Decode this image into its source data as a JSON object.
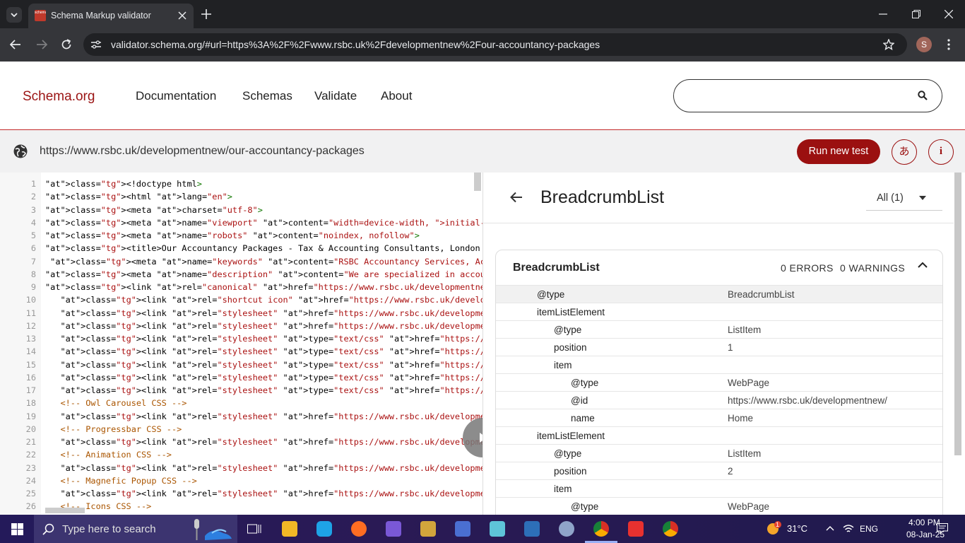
{
  "browser": {
    "tab_title": "Schema Markup validator",
    "tab_favicon_text": "schema.org",
    "url": "validator.schema.org/#url=https%3A%2F%2Fwww.rsbc.uk%2Fdevelopmentnew%2Four-accountancy-packages",
    "profile_initial": "S"
  },
  "site": {
    "logo": "Schema.org",
    "nav": [
      "Documentation",
      "Schemas",
      "Validate",
      "About"
    ],
    "search_placeholder": ""
  },
  "test": {
    "url": "https://www.rsbc.uk/developmentnew/our-accountancy-packages",
    "run_label": "Run new test",
    "lang_label": "あ",
    "info_label": "i"
  },
  "code": {
    "line_numbers": [
      "1",
      "2",
      "3",
      "4",
      "5",
      "6",
      "7",
      "8",
      "9",
      "10",
      "11",
      "12",
      "13",
      "14",
      "15",
      "16",
      "17",
      "18",
      "19",
      "20",
      "21",
      "22",
      "23",
      "24",
      "25",
      "26"
    ],
    "lines": [
      "<!doctype html>",
      "<html lang=\"en\">",
      "<meta charset=\"utf-8\">",
      "<meta name=\"viewport\" content=\"width=device-width, initial-scale=1\">",
      "<meta name=\"robots\" content=\"noindex, nofollow\">",
      "<title>Our Accountancy Packages - Tax & Accounting Consultants, London | Management Acc",
      " <meta name=\"keywords\" content=\"RSBC Accountancy Services, Accounts, Tax, Payroll, Mana",
      "<meta name=\"description\" content=\"We are specialized in accountancy and tax advice prov",
      "<link rel=\"canonical\" href=\"https://www.rsbc.uk/developmentnew/our-accountancy-packages",
      "   <link rel=\"shortcut icon\" href=\"https://www.rsbc.uk/developmentnew/images/favicon.ic",
      "   <link rel=\"stylesheet\" href=\"https://www.rsbc.uk/developmentnew/css/bootstrap.min.cs",
      "   <link rel=\"stylesheet\" href=\"https://www.rsbc.uk/developmentnew/css/jquery.mCustomSc",
      "   <link rel=\"stylesheet\" type=\"text/css\" href=\"https://www.rsbc.uk/developmentnew/css/",
      "   <link rel=\"stylesheet\" type=\"text/css\" href=\"https://www.rsbc.uk/developmentnew/css/",
      "   <link rel=\"stylesheet\" type=\"text/css\" href=\"https://www.rsbc.uk/developmentnew/css/",
      "   <link rel=\"stylesheet\" type=\"text/css\" href=\"https://www.rsbc.uk/developmentnew/css/",
      "   <link rel=\"stylesheet\" type=\"text/css\" href=\"https://www.rsbc.uk/developmentnew/css/",
      "   <!-- Owl Carousel CSS -->",
      "   <link rel=\"stylesheet\" href=\"https://www.rsbc.uk/developmentnew/css/owl.carousel.min",
      "   <!-- Progressbar CSS -->",
      "   <link rel=\"stylesheet\" href=\"https://www.rsbc.uk/developmentnew/css/progressbar.",
      "   <!-- Animation CSS -->",
      "   <link rel=\"stylesheet\" href=\"https://www.rsbc.uk/developmentnew/css/animations.min.c",
      "   <!-- Magnefic Popup CSS -->",
      "   <link rel=\"stylesheet\" href=\"https://www.rsbc.uk/developmentnew/css/magnific-popup.m",
      "   <!-- Icons CSS -->"
    ]
  },
  "results": {
    "title": "BreadcrumbList",
    "filter": "All (1)",
    "card": {
      "heading": "BreadcrumbList",
      "errors": "0 ERRORS",
      "warnings": "0 WARNINGS",
      "rows": [
        {
          "key": "@type",
          "value": "BreadcrumbList",
          "level": 0
        },
        {
          "key": "itemListElement",
          "value": "",
          "level": 0
        },
        {
          "key": "@type",
          "value": "ListItem",
          "level": 1
        },
        {
          "key": "position",
          "value": "1",
          "level": 1
        },
        {
          "key": "item",
          "value": "",
          "level": 1
        },
        {
          "key": "@type",
          "value": "WebPage",
          "level": 2
        },
        {
          "key": "@id",
          "value": "https://www.rsbc.uk/developmentnew/",
          "level": 2
        },
        {
          "key": "name",
          "value": "Home",
          "level": 2
        },
        {
          "key": "itemListElement",
          "value": "",
          "level": 0
        },
        {
          "key": "@type",
          "value": "ListItem",
          "level": 1
        },
        {
          "key": "position",
          "value": "2",
          "level": 1
        },
        {
          "key": "item",
          "value": "",
          "level": 1
        },
        {
          "key": "@type",
          "value": "WebPage",
          "level": 2
        }
      ]
    }
  },
  "taskbar": {
    "search_placeholder": "Type here to search",
    "temperature": "31°C",
    "language": "ENG",
    "time": "4:00 PM",
    "date": "08-Jan-25",
    "weather_badge": "1"
  }
}
